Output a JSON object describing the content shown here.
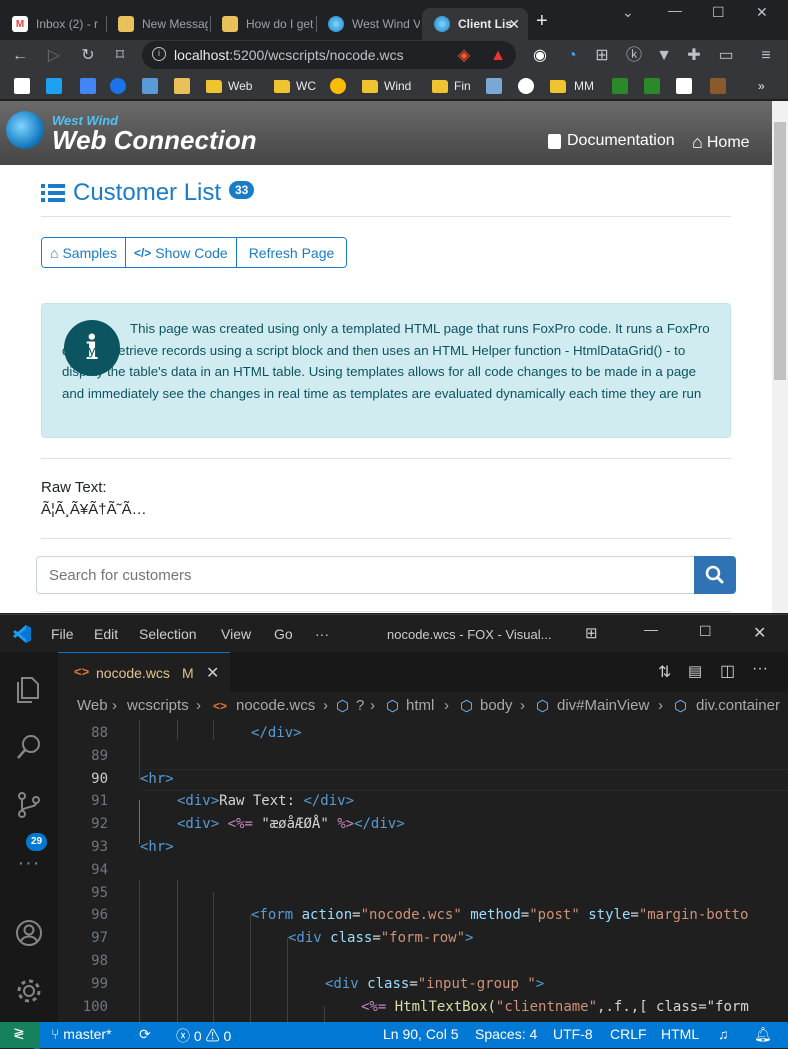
{
  "browser": {
    "tabs": [
      {
        "title": "Inbox (2) - r",
        "icon": "gmail-icon"
      },
      {
        "title": "New Messag",
        "icon": "notepad-icon"
      },
      {
        "title": "How do I get",
        "icon": "notepad-icon"
      },
      {
        "title": "West Wind V",
        "icon": "westwind-icon"
      },
      {
        "title": "Client Lis",
        "icon": "westwind-icon",
        "active": true
      }
    ],
    "url_host": "localhost",
    "url_path": ":5200/wcscripts/nocode.wcs",
    "bookmarks": [
      {
        "label": "",
        "icon": "gmail-icon"
      },
      {
        "label": "",
        "icon": "twitter-icon"
      },
      {
        "label": "",
        "icon": "calendar-icon"
      },
      {
        "label": "",
        "icon": "contacts-icon"
      },
      {
        "label": "",
        "icon": "translate-icon"
      },
      {
        "label": "",
        "icon": "notepad-icon"
      },
      {
        "label": "Web",
        "icon": "folder-icon"
      },
      {
        "label": "WC",
        "icon": "folder-icon"
      },
      {
        "label": "",
        "icon": "chrome-icon"
      },
      {
        "label": "Wind",
        "icon": "folder-icon"
      },
      {
        "label": "Fin",
        "icon": "folder-icon"
      },
      {
        "label": "",
        "icon": "form-icon"
      },
      {
        "label": "",
        "icon": "github-icon"
      },
      {
        "label": "",
        "icon": "folder-icon"
      },
      {
        "label": "MM",
        "icon": "folder-icon"
      },
      {
        "label": "",
        "icon": "td-icon"
      },
      {
        "label": "",
        "icon": "td-icon"
      },
      {
        "label": "",
        "icon": "tradingview-icon"
      },
      {
        "label": "",
        "icon": "rabbit-icon"
      }
    ]
  },
  "site": {
    "brand_small": "West Wind",
    "brand_big": "Web Connection",
    "nav": {
      "documentation": "Documentation",
      "home": "Home"
    },
    "title": "Customer List",
    "count": "33",
    "buttons": {
      "samples": "Samples",
      "show_code": "Show Code",
      "refresh": "Refresh Page"
    },
    "info_text": "This page was created using only a templated HTML page that runs FoxPro code. It runs a FoxPro query to retrieve records using a script block and then uses an HTML Helper function - HtmlDataGrid() - to display the table's data in an HTML table. Using templates allows for all code changes to be made in a page and immediately see the changes in real time as templates are evaluated dynamically each time they are run",
    "raw_label": "Raw Text:",
    "raw_value": "Ã¦Ã¸Ã¥Ã†Ã˜Ã…",
    "search_placeholder": "Search for customers"
  },
  "vscode": {
    "menu": [
      "File",
      "Edit",
      "Selection",
      "View",
      "Go",
      "···"
    ],
    "window_title": "nocode.wcs - FOX - Visual...",
    "scm_count": "29",
    "settings_badge": "1",
    "tab_name": "nocode.wcs",
    "tab_status": "M",
    "breadcrumbs": [
      "Web",
      "wcscripts",
      "nocode.wcs",
      "?",
      "html",
      "body",
      "div#MainView",
      "div.container"
    ],
    "line_numbers": [
      "88",
      "89",
      "90",
      "91",
      "92",
      "93",
      "94",
      "95",
      "96",
      "97",
      "98",
      "99",
      "100"
    ],
    "code": {
      "l88": "</div>",
      "l90": "<hr>",
      "l91_open": "<div>",
      "l91_text": "Raw Text: ",
      "l91_close": "</div>",
      "l92_open": "<div>",
      "l92_script_open": "<%=",
      "l92_string": "\"æøåÆØÅ\"",
      "l92_script_close": "%>",
      "l92_close": "</div>",
      "l93": "<hr>",
      "l96_tag": "<form",
      "l96_a1": "action",
      "l96_v1": "\"nocode.wcs\"",
      "l96_a2": "method",
      "l96_v2": "\"post\"",
      "l96_a3": "style",
      "l96_v3": "\"margin-botto",
      "l97_tag": "<div",
      "l97_a1": "class",
      "l97_v1": "\"form-row\"",
      "l97_end": ">",
      "l99_tag": "<div",
      "l99_a1": "class",
      "l99_v1": "\"input-group \"",
      "l99_end": ">",
      "l100_script": "<%=",
      "l100_fn": "HtmlTextBox(",
      "l100_s1": "\"clientname\"",
      "l100_rest": ",.f.,[ class=\"form"
    },
    "status": {
      "branch": "master*",
      "errors": "0",
      "warnings": "0",
      "position": "Ln 90, Col 5",
      "spaces": "Spaces: 4",
      "encoding": "UTF-8",
      "eol": "CRLF",
      "language": "HTML"
    }
  }
}
